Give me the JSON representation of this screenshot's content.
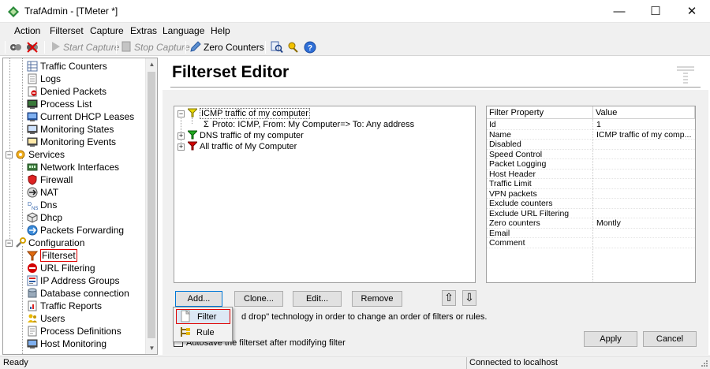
{
  "window": {
    "title": "TrafAdmin - [TMeter *]",
    "minimize": "—",
    "maximize": "☐",
    "close": "✕"
  },
  "menu": {
    "items": [
      "Action",
      "Filterset",
      "Capture",
      "Extras",
      "Language",
      "Help"
    ]
  },
  "toolbar": {
    "start_capture": "Start Capture",
    "stop_capture": "Stop Capture",
    "zero_counters": "Zero Counters"
  },
  "tree": {
    "items": [
      {
        "label": "Traffic Counters",
        "icon": "table-icon"
      },
      {
        "label": "Logs",
        "icon": "log-icon"
      },
      {
        "label": "Denied Packets",
        "icon": "denied-packets-icon"
      },
      {
        "label": "Process List",
        "icon": "process-list-icon"
      },
      {
        "label": "Current DHCP Leases",
        "icon": "dhcp-leases-icon"
      },
      {
        "label": "Monitoring States",
        "icon": "monitoring-states-icon"
      },
      {
        "label": "Monitoring Events",
        "icon": "monitoring-events-icon"
      },
      {
        "label": "Services",
        "icon": "gear-icon"
      },
      {
        "label": "Network Interfaces",
        "icon": "network-interfaces-icon"
      },
      {
        "label": "Firewall",
        "icon": "firewall-icon"
      },
      {
        "label": "NAT",
        "icon": "nat-icon"
      },
      {
        "label": "Dns",
        "icon": "dns-icon"
      },
      {
        "label": "Dhcp",
        "icon": "dhcp-icon"
      },
      {
        "label": "Packets Forwarding",
        "icon": "packets-forwarding-icon"
      },
      {
        "label": "Configuration",
        "icon": "wrench-icon"
      },
      {
        "label": "Filterset",
        "icon": "filter-icon"
      },
      {
        "label": "URL Filtering",
        "icon": "no-entry-icon"
      },
      {
        "label": "IP Address Groups",
        "icon": "ip-groups-icon"
      },
      {
        "label": "Database connection",
        "icon": "database-icon"
      },
      {
        "label": "Traffic Reports",
        "icon": "reports-icon"
      },
      {
        "label": "Users",
        "icon": "users-icon"
      },
      {
        "label": "Process Definitions",
        "icon": "process-definitions-icon"
      },
      {
        "label": "Host Monitoring",
        "icon": "host-monitoring-icon"
      }
    ]
  },
  "editor": {
    "title": "Filterset Editor",
    "filters": [
      {
        "label": "ICMP traffic of my computer",
        "color": "#e8d800"
      },
      {
        "label": "Proto: ICMP, From: My Computer=> To: Any address"
      },
      {
        "label": "DNS traffic of my computer",
        "color": "#1faa1f"
      },
      {
        "label": "All traffic of My Computer",
        "color": "#d40000"
      }
    ],
    "sigma": "Σ",
    "props_header": {
      "property": "Filter Property",
      "value": "Value"
    },
    "props": [
      {
        "name": "Id",
        "value": "1"
      },
      {
        "name": "Name",
        "value": "ICMP traffic of my comp..."
      },
      {
        "name": "Disabled",
        "value": ""
      },
      {
        "name": "Speed Control",
        "value": ""
      },
      {
        "name": "Packet Logging",
        "value": ""
      },
      {
        "name": "Host Header",
        "value": ""
      },
      {
        "name": "Traffic Limit",
        "value": ""
      },
      {
        "name": "VPN packets",
        "value": ""
      },
      {
        "name": "Exclude counters",
        "value": ""
      },
      {
        "name": "Exclude URL Filtering",
        "value": ""
      },
      {
        "name": "Zero counters",
        "value": "Montly"
      },
      {
        "name": "Email",
        "value": ""
      },
      {
        "name": "Comment",
        "value": ""
      }
    ],
    "buttons": {
      "add": "Add...",
      "clone": "Clone...",
      "edit": "Edit...",
      "remove": "Remove",
      "up": "⇧",
      "down": "⇩",
      "apply": "Apply",
      "cancel": "Cancel"
    },
    "hint": "d drop\" technology in order to change an order of filters or rules.",
    "autosave": "Autosave the filterset after modifying filter"
  },
  "add_menu": {
    "filter": "Filter",
    "rule": "Rule"
  },
  "status": {
    "left": "Ready",
    "right": "Connected to localhost"
  }
}
